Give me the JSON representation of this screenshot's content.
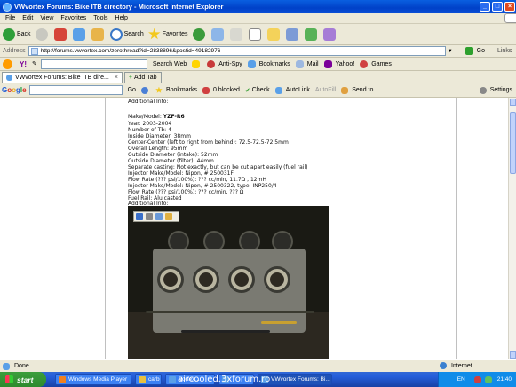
{
  "window": {
    "title": "VWvortex Forums: Bike ITB directory - Microsoft Internet Explorer"
  },
  "menu": [
    "File",
    "Edit",
    "View",
    "Favorites",
    "Tools",
    "Help"
  ],
  "toolbar": {
    "back": "Back",
    "search": "Search",
    "favorites": "Favorites"
  },
  "address": {
    "label": "Address",
    "url": "http://forums.vwvortex.com/zerothread?id=2838896&postid=49182976",
    "go": "Go",
    "links": "Links"
  },
  "yahoo_bar": {
    "search_web": "Search Web",
    "anti_spy": "Anti-Spy",
    "bookmarks": "Bookmarks",
    "mail": "Mail",
    "yahoo": "Yahoo!",
    "games": "Games"
  },
  "tabs": {
    "active": "VWvortex Forums: Bike ITB dire...",
    "add": "Add Tab"
  },
  "google_bar": {
    "logo": [
      "G",
      "o",
      "o",
      "g",
      "l",
      "e"
    ],
    "go": "Go",
    "bookmarks": "Bookmarks",
    "blocked": "0 blocked",
    "check": "Check",
    "autolink": "AutoLink",
    "autofill": "AutoFill",
    "send_to": "Send to",
    "settings": "Settings"
  },
  "post": {
    "lines": [
      "Additional Info:",
      "",
      "Make/Model: YZF-R6",
      "Year: 2003-2004",
      "Number of Tb: 4",
      "Inside Diameter: 38mm",
      "Center-Center (left to right from behind): 72.5-72.5-72.5mm",
      "Overall Length: 95mm",
      "Outside Diameter (intake): 52mm",
      "Outside Diameter (filter): 44mm",
      "Separate casting: Not exactly, but can be cut apart easily (fuel rail)",
      "Injector Make/Model: Nipon, # 250031F",
      "Flow Rate (??? psi/100%): ??? cc/min, 11.7Ω , 12mH",
      "Injector Make/Model: Nipon, # 2500322, type: INP250/4",
      "Flow Rate (??? psi/100%): ??? cc/min, ??? Ω",
      "Fuel Rail: Alu casted",
      "Additional Info:"
    ]
  },
  "status": {
    "text": "Done",
    "zone": "Internet"
  },
  "taskbar": {
    "start": "start",
    "items": [
      "Windows Media Player",
      "carb",
      "Vortex...",
      "",
      "VWvortex Forums: Bi..."
    ],
    "lang": "EN",
    "time": "21:40"
  },
  "watermark": "aircooled.3xforum.ro"
}
